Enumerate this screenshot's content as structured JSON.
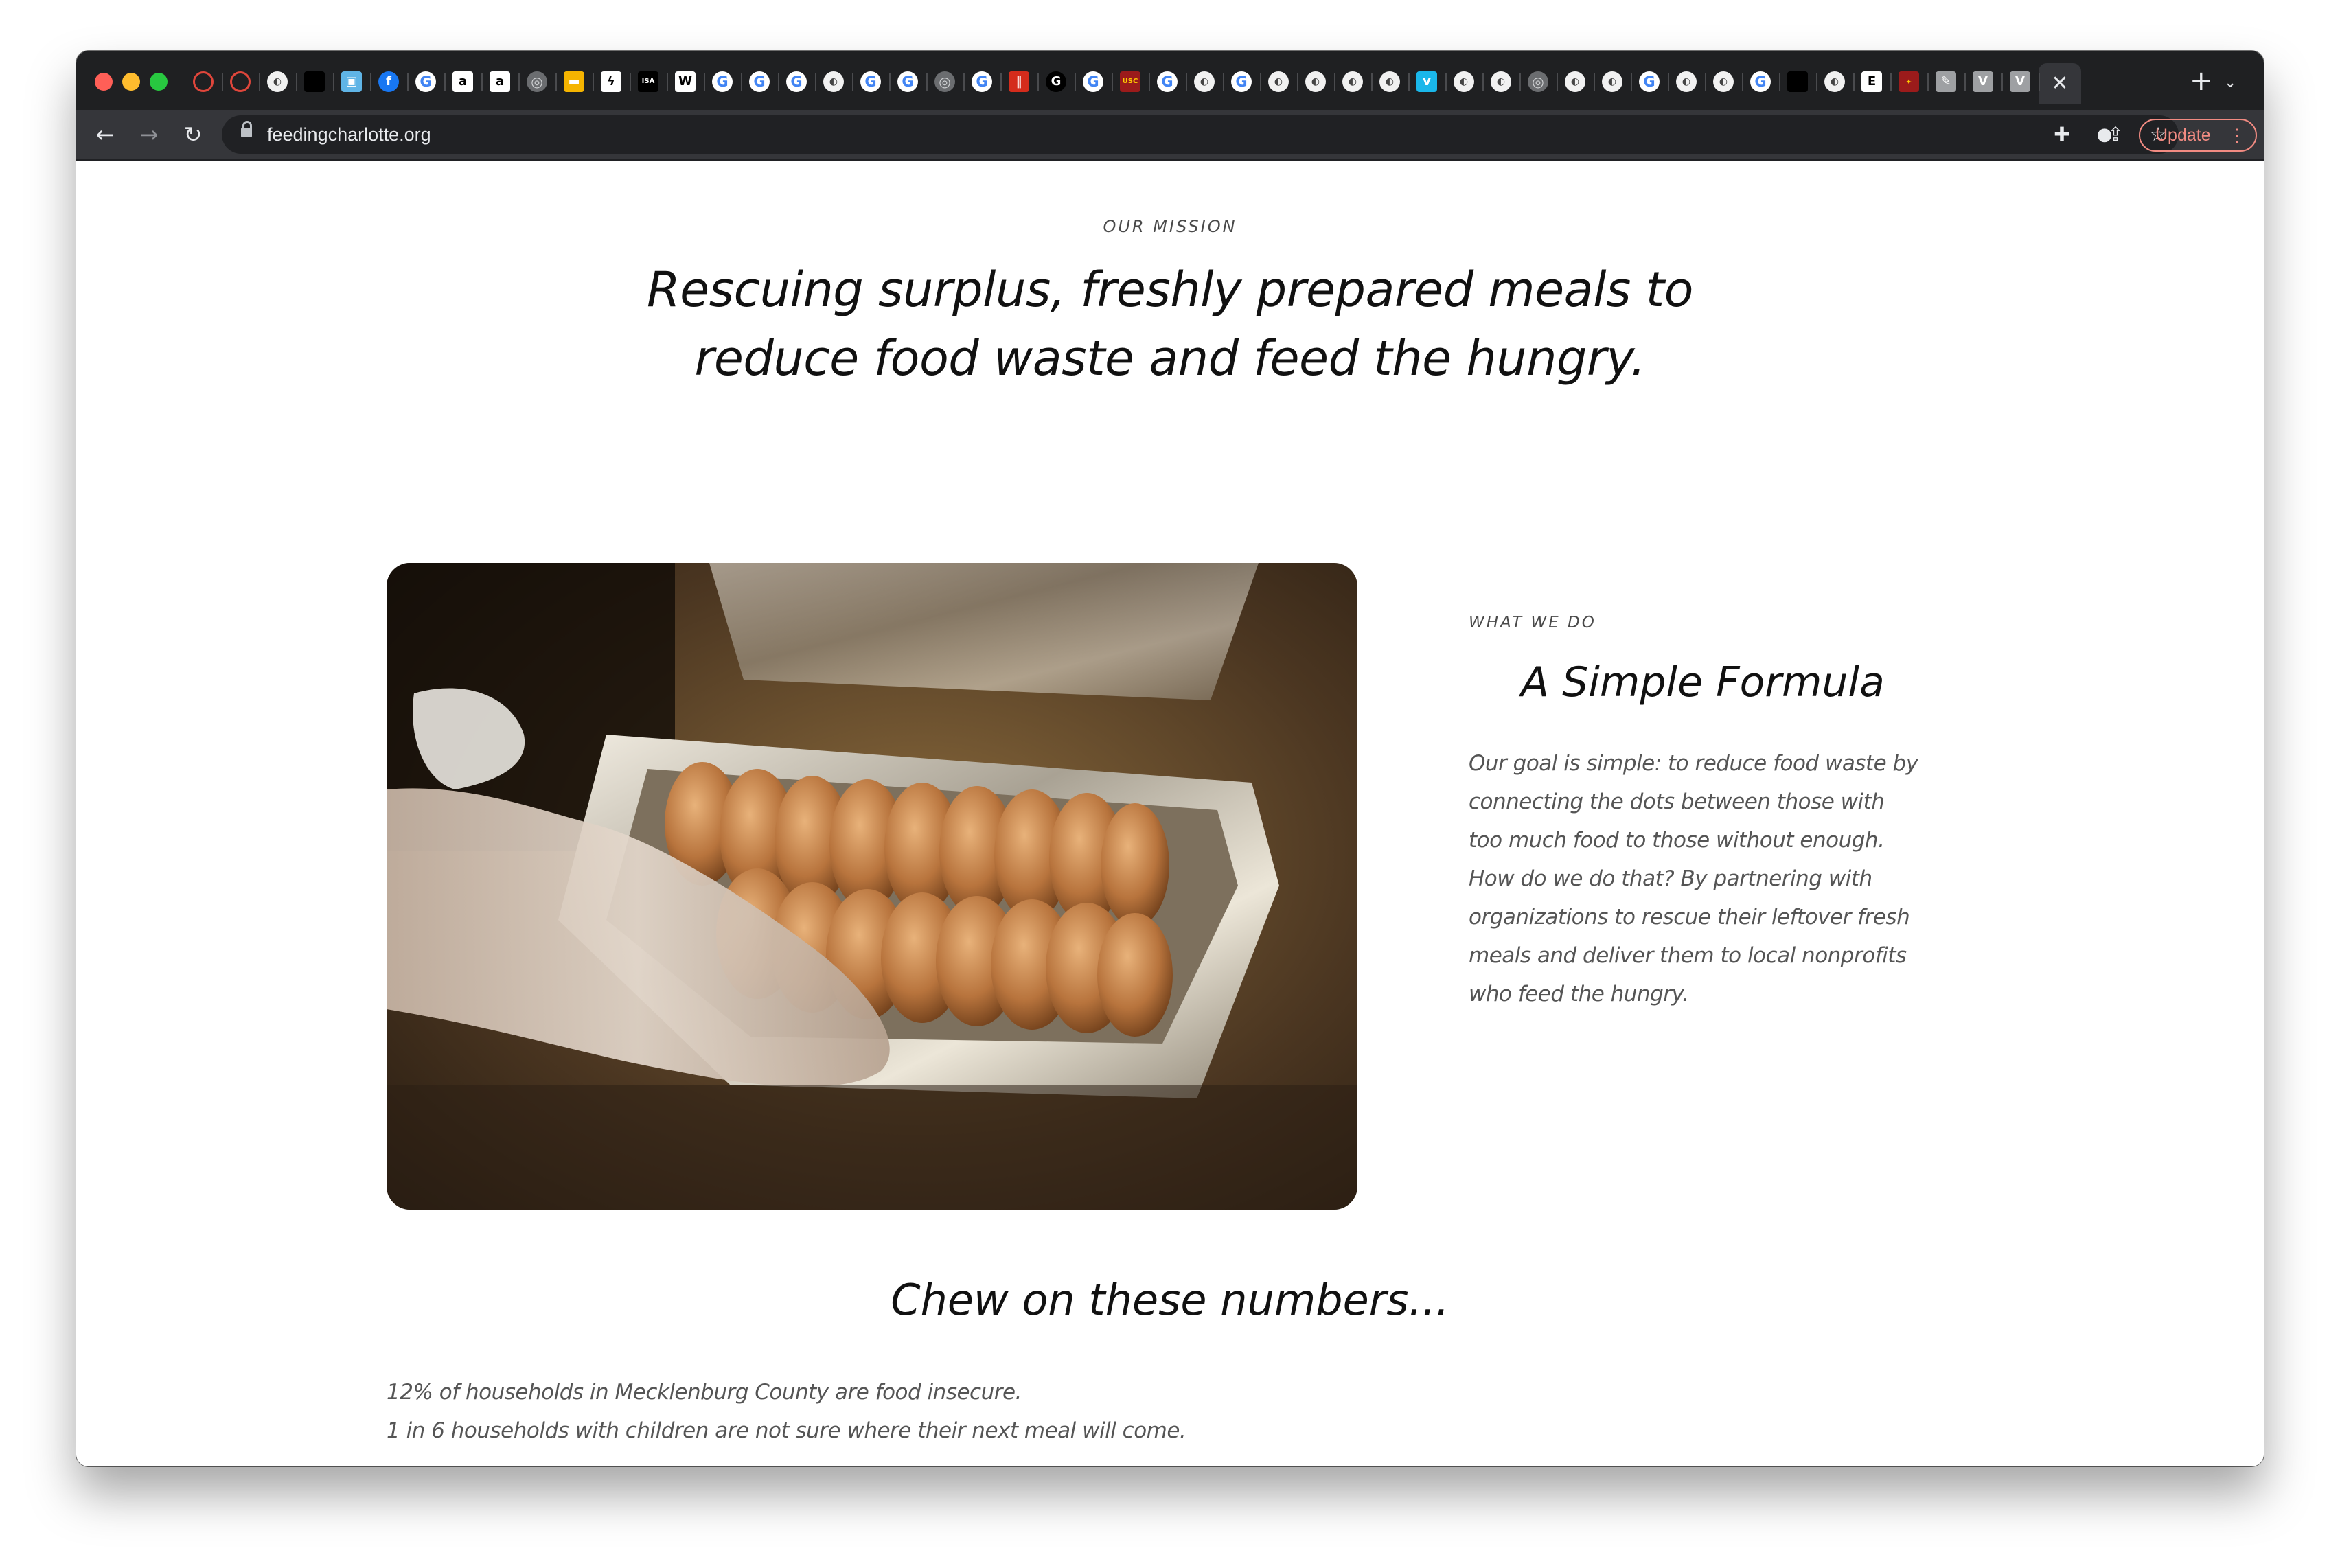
{
  "browser": {
    "favicons": [
      "orange-ring",
      "orange-ring",
      "owl",
      "square-black",
      "browser-blue",
      "facebook",
      "google",
      "amazon",
      "amazon",
      "globe",
      "folder-amber",
      "bolt",
      "isa",
      "wikipedia",
      "google",
      "google",
      "google",
      "owl",
      "google",
      "google",
      "globe",
      "google",
      "parallel-red",
      "g-black",
      "google",
      "usc",
      "google",
      "owl",
      "google",
      "owl",
      "owl",
      "owl",
      "owl",
      "vimeo",
      "owl",
      "owl",
      "globe",
      "owl",
      "owl",
      "google",
      "owl",
      "owl",
      "google",
      "square-black",
      "owl",
      "e-book",
      "seal",
      "pen",
      "v-tab",
      "v-tab"
    ],
    "favicon_glyphs": {
      "owl": "◐",
      "google": "G",
      "globe": "◎",
      "square-black": "",
      "facebook": "f",
      "amazon": "a",
      "folder-amber": "▬",
      "bolt": "ϟ",
      "isa": "ISA",
      "wikipedia": "W",
      "parallel-red": "‖",
      "g-black": "G",
      "usc": "USC",
      "vimeo": "v",
      "e-book": "E",
      "seal": "✦",
      "pen": "✎",
      "v-tab": "V",
      "browser-blue": "▣",
      "orange-ring": ""
    },
    "active_tab_close": "✕",
    "new_tab": "+",
    "tab_search": "⌄",
    "back": "←",
    "forward": "→",
    "reload": "↻",
    "url": "feedingcharlotte.org",
    "share_icon": "⇪",
    "bookmark_icon": "☆",
    "extensions_icon": "✚",
    "profile_icon": "●",
    "update_label": "Update",
    "menu_dots": "⋮"
  },
  "mission": {
    "kicker": "OUR MISSION",
    "line1": "Rescuing surplus, freshly prepared meals to",
    "line2": "reduce food waste and feed the hungry."
  },
  "what_we_do": {
    "kicker": "WHAT WE DO",
    "title": "A Simple Formula",
    "body_lines": [
      "Our goal is simple: to reduce food waste by",
      "connecting the dots between those with",
      "too much food to those without enough.",
      "How do we do that? By partnering with",
      "organizations to rescue their leftover fresh",
      "meals and deliver them to local nonprofits",
      "who feed the hungry."
    ]
  },
  "numbers": {
    "title": "Chew on these numbers...",
    "stats": [
      "12% of households in Mecklenburg County are food insecure.",
      "1 in 6 households with children are not sure where their next meal will come."
    ]
  }
}
